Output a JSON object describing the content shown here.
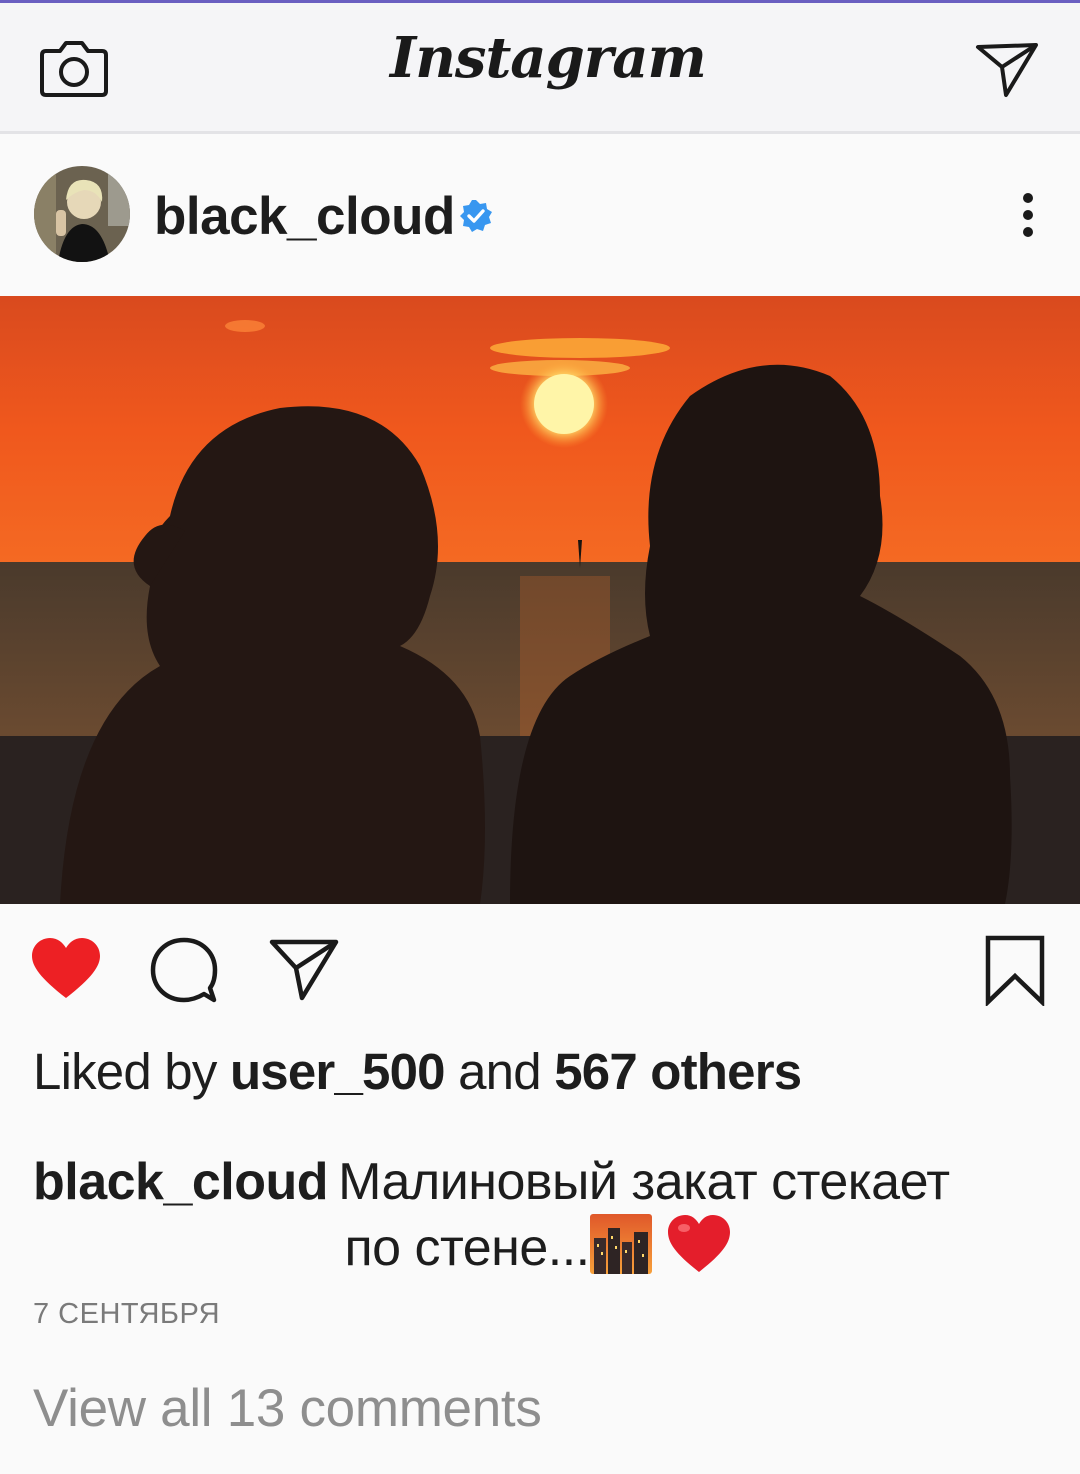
{
  "app": {
    "title": "Instagram",
    "accent_color": "#6a5fc1"
  },
  "toolbar": {
    "camera_icon": "camera-icon",
    "direct_icon": "paper-plane-icon"
  },
  "post": {
    "username": "black_cloud",
    "verified": true,
    "verified_color": "#3897f0",
    "more_icon": "vertical-dots-icon",
    "photo_description": "Silhouettes of two people watching an orange sunset over the sea with a sailboat",
    "liked": true,
    "like_color": "#ed2024",
    "likes": {
      "prefix": "Liked by",
      "user": "user_500",
      "middle": "and",
      "others": "567 others"
    },
    "caption": {
      "user": "black_cloud",
      "line1": "Малиновый закат стекает",
      "line2": "по стене..."
    },
    "date": "7 СЕНТЯБРЯ",
    "view_comments": "View all 13 comments"
  }
}
